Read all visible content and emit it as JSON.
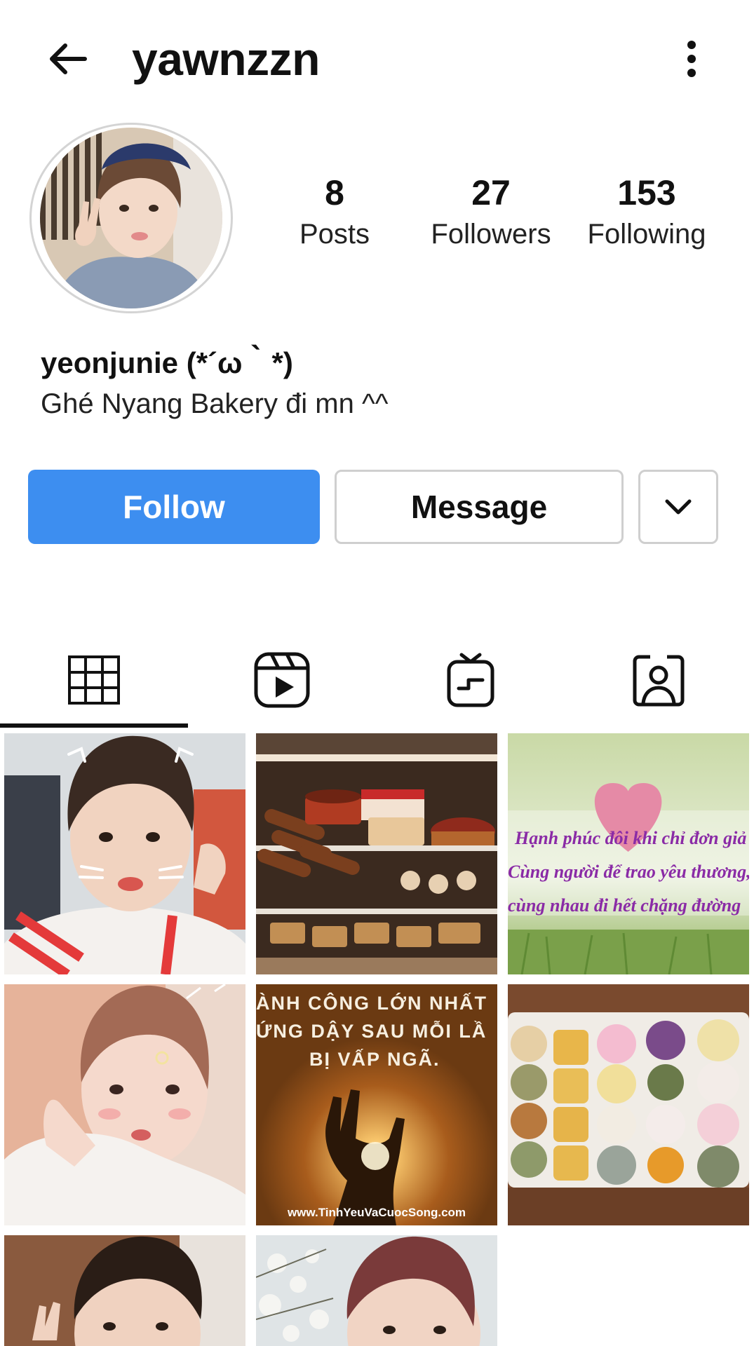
{
  "header": {
    "username": "yawnzzn",
    "back_icon": "arrow-left-icon",
    "more_icon": "more-vertical-icon"
  },
  "profile": {
    "full_name": "yeonjunie (*´ω｀*)",
    "bio": "Ghé Nyang Bakery đi mn ^^",
    "stats": {
      "posts": {
        "value": "8",
        "label": "Posts"
      },
      "followers": {
        "value": "27",
        "label": "Followers"
      },
      "following": {
        "value": "153",
        "label": "Following"
      }
    }
  },
  "actions": {
    "follow_label": "Follow",
    "message_label": "Message",
    "dropdown_icon": "chevron-down-icon"
  },
  "tabs": [
    {
      "icon": "grid-icon",
      "active": true
    },
    {
      "icon": "reels-icon",
      "active": false
    },
    {
      "icon": "igtv-icon",
      "active": false
    },
    {
      "icon": "tagged-icon",
      "active": false
    }
  ],
  "posts": {
    "post3_caption_lines": [
      "Hạnh phúc đôi khi chỉ đơn giả",
      "Cùng người để trao yêu thương,",
      "cùng nhau đi hết chặng đường"
    ],
    "post5_quote_lines": [
      "ÀNH CÔNG LỚN NHẤT",
      "ỨNG DẬY SAU MỖI LẦ",
      "BỊ VẤP NGÃ."
    ],
    "post5_url": "www.TinhYeuVaCuocSong.com"
  },
  "colors": {
    "follow_button": "#3d8ef0",
    "border": "#cfcfcf",
    "text": "#111111"
  }
}
